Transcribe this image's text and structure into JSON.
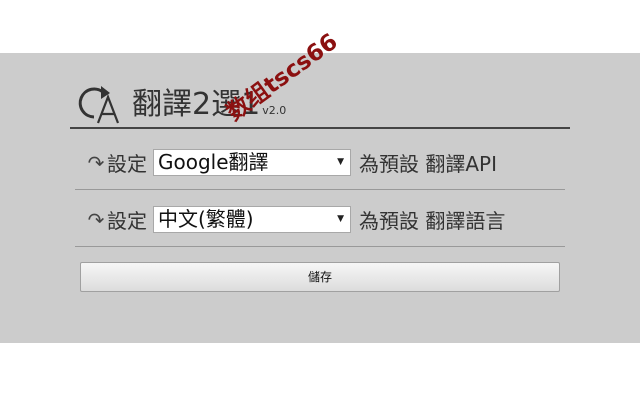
{
  "app": {
    "title": "翻譯2選1",
    "version": "v2.0",
    "watermark": "数组tscs66",
    "logo_icon": "redo-arrow-letter-a-icon"
  },
  "rows": [
    {
      "arrow_icon": "↷",
      "prefix": "設定",
      "selected": "Google翻譯",
      "suffix": "為預設 翻譯API"
    },
    {
      "arrow_icon": "↷",
      "prefix": "設定",
      "selected": "中文(繁體)",
      "suffix": "為預設 翻譯語言"
    }
  ],
  "caret": "▼",
  "save_label": "儲存",
  "colors": {
    "panel_bg": "#cccccc",
    "watermark": "#8b1010",
    "text": "#333333"
  }
}
